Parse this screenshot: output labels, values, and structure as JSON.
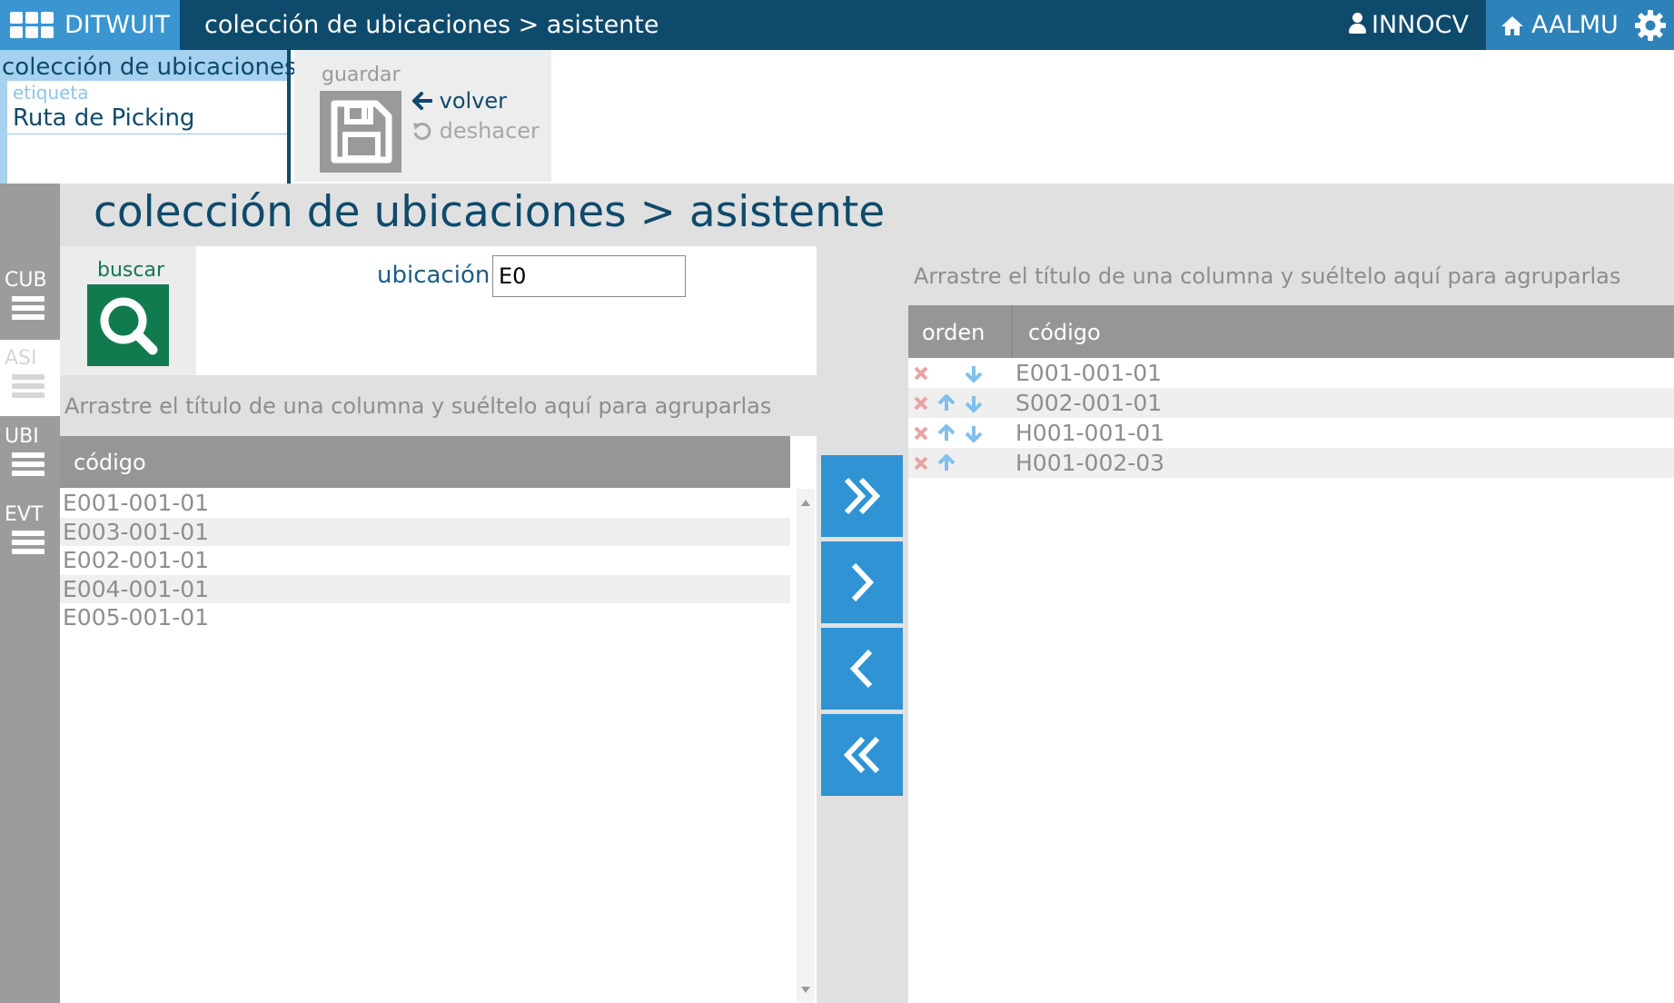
{
  "topbar": {
    "brand": "DITWUIT",
    "title": "colección de ubicaciones > asistente",
    "user": "INNOCV",
    "company": "AALMU"
  },
  "collection_panel": {
    "heading": "colección de ubicaciones",
    "field_label": "etiqueta",
    "field_value": "Ruta de Picking"
  },
  "actions": {
    "save_label": "guardar",
    "back_label": "volver",
    "undo_label": "deshacer"
  },
  "sidenav": {
    "items": [
      {
        "label": "CUB",
        "active": false
      },
      {
        "label": "ASI",
        "active": true
      },
      {
        "label": "UBI",
        "active": false
      },
      {
        "label": "EVT",
        "active": false
      }
    ]
  },
  "main": {
    "title": "colección de ubicaciones > asistente"
  },
  "search": {
    "button_label": "buscar",
    "field_label": "ubicación",
    "value": "E0"
  },
  "left_grid": {
    "group_hint": "Arrastre el título de una columna y suéltelo aquí para agruparlas",
    "column": "código",
    "rows": [
      "E001-001-01",
      "E003-001-01",
      "E002-001-01",
      "E004-001-01",
      "E005-001-01"
    ]
  },
  "right_grid": {
    "group_hint": "Arrastre el título de una columna y suéltelo aquí para agruparlas",
    "columns": {
      "order": "orden",
      "code": "código"
    },
    "rows": [
      {
        "code": "E001-001-01",
        "can_up": false,
        "can_down": true
      },
      {
        "code": "S002-001-01",
        "can_up": true,
        "can_down": true
      },
      {
        "code": "H001-001-01",
        "can_up": true,
        "can_down": true
      },
      {
        "code": "H001-002-03",
        "can_up": true,
        "can_down": false
      }
    ]
  },
  "transfer_buttons": [
    {
      "icon": "double-chevron-right-icon",
      "action": "move-all-right"
    },
    {
      "icon": "chevron-right-icon",
      "action": "move-right"
    },
    {
      "icon": "chevron-left-icon",
      "action": "move-left"
    },
    {
      "icon": "double-chevron-left-icon",
      "action": "move-all-left"
    }
  ],
  "colors": {
    "topbar": "#0e4a6b",
    "accent": "#2f93d4",
    "search_button": "#117a4f",
    "delete": "#e9a3a3",
    "arrows": "#7fc0ec"
  }
}
